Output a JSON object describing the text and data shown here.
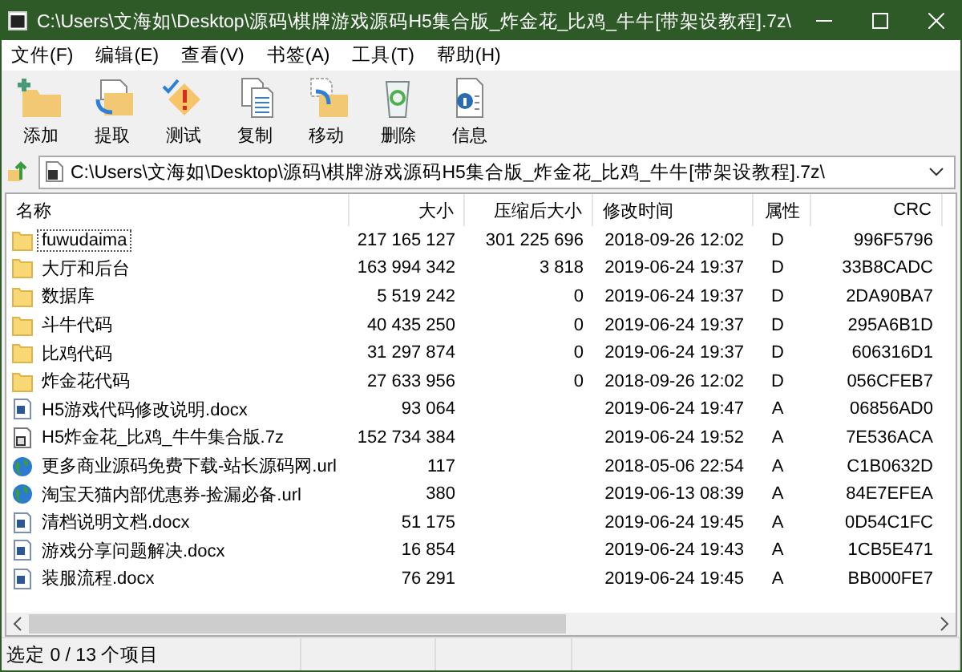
{
  "window": {
    "title": "C:\\Users\\文海如\\Desktop\\源码\\棋牌游戏源码H5集合版_炸金花_比鸡_牛牛[带架设教程].7z\\"
  },
  "menu": [
    "文件(F)",
    "编辑(E)",
    "查看(V)",
    "书签(A)",
    "工具(T)",
    "帮助(H)"
  ],
  "toolbar": [
    {
      "kind": "add",
      "label": "添加"
    },
    {
      "kind": "extract",
      "label": "提取"
    },
    {
      "kind": "test",
      "label": "测试"
    },
    {
      "kind": "copy",
      "label": "复制"
    },
    {
      "kind": "move",
      "label": "移动"
    },
    {
      "kind": "delete",
      "label": "删除"
    },
    {
      "kind": "info",
      "label": "信息"
    }
  ],
  "address": {
    "value": "C:\\Users\\文海如\\Desktop\\源码\\棋牌游戏源码H5集合版_炸金花_比鸡_牛牛[带架设教程].7z\\"
  },
  "table": {
    "columns": [
      "名称",
      "大小",
      "压缩后大小",
      "修改时间",
      "属性",
      "CRC"
    ],
    "rows": [
      {
        "kind": "folder",
        "focused": true,
        "cells": [
          "fuwudaima",
          "217 165 127",
          "301 225 696",
          "2018-09-26 12:02",
          "D",
          "996F5796"
        ]
      },
      {
        "kind": "folder",
        "focused": false,
        "cells": [
          "大厅和后台",
          "163 994 342",
          "3 818",
          "2019-06-24 19:37",
          "D",
          "33B8CADC"
        ]
      },
      {
        "kind": "folder",
        "focused": false,
        "cells": [
          "数据库",
          "5 519 242",
          "0",
          "2019-06-24 19:37",
          "D",
          "2DA90BA7"
        ]
      },
      {
        "kind": "folder",
        "focused": false,
        "cells": [
          "斗牛代码",
          "40 435 250",
          "0",
          "2019-06-24 19:37",
          "D",
          "295A6B1D"
        ]
      },
      {
        "kind": "folder",
        "focused": false,
        "cells": [
          "比鸡代码",
          "31 297 874",
          "0",
          "2019-06-24 19:37",
          "D",
          "606316D1"
        ]
      },
      {
        "kind": "folder",
        "focused": false,
        "cells": [
          "炸金花代码",
          "27 633 956",
          "0",
          "2018-09-26 12:02",
          "D",
          "056CFEB7"
        ]
      },
      {
        "kind": "docx",
        "focused": false,
        "cells": [
          "H5游戏代码修改说明.docx",
          "93 064",
          "",
          "2019-06-24 19:47",
          "A",
          "06856AD0"
        ]
      },
      {
        "kind": "archive",
        "focused": false,
        "cells": [
          "H5炸金花_比鸡_牛牛集合版.7z",
          "152 734 384",
          "",
          "2019-06-24 19:52",
          "A",
          "7E536ACA"
        ]
      },
      {
        "kind": "url",
        "focused": false,
        "cells": [
          "更多商业源码免费下载-站长源码网.url",
          "117",
          "",
          "2018-05-06 22:54",
          "A",
          "C1B0632D"
        ]
      },
      {
        "kind": "url",
        "focused": false,
        "cells": [
          "淘宝天猫内部优惠券-捡漏必备.url",
          "380",
          "",
          "2019-06-13 08:39",
          "A",
          "84E7EFEA"
        ]
      },
      {
        "kind": "docx",
        "focused": false,
        "cells": [
          "清档说明文档.docx",
          "51 175",
          "",
          "2019-06-24 19:45",
          "A",
          "0D54C1FC"
        ]
      },
      {
        "kind": "docx",
        "focused": false,
        "cells": [
          "游戏分享问题解决.docx",
          "16 854",
          "",
          "2019-06-24 19:43",
          "A",
          "1CB5E471"
        ]
      },
      {
        "kind": "docx",
        "focused": false,
        "cells": [
          "装服流程.docx",
          "76 291",
          "",
          "2019-06-24 19:45",
          "A",
          "BB000FE7"
        ]
      }
    ]
  },
  "status_bar": [
    "选定 0 / 13 个项目"
  ]
}
